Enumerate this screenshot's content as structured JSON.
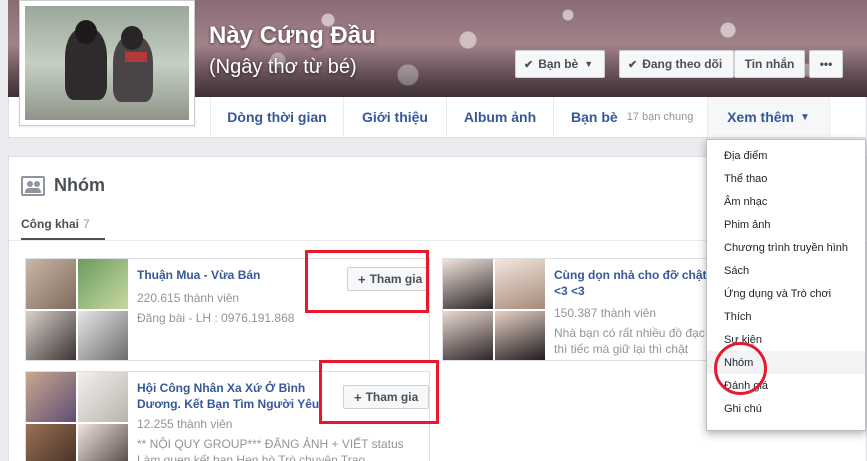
{
  "profile": {
    "name": "Này Cứng Đầu",
    "alt_name": "(Ngây thơ từ bé)"
  },
  "actions": {
    "friends": "Bạn bè",
    "following": "Đang theo dõi",
    "message": "Tin nhắn",
    "more": "•••"
  },
  "nav": {
    "timeline": "Dòng thời gian",
    "about": "Giới thiệu",
    "photos": "Album ảnh",
    "friends": "Bạn bè",
    "mutual": "17 bạn chung",
    "more": "Xem thêm"
  },
  "groups": {
    "title": "Nhóm",
    "subtab_label": "Công khai",
    "subtab_count": "7",
    "cards": [
      {
        "title": "Thuận Mua - Vừa Bán",
        "members": "220.615 thành viên",
        "desc": "Đăng bài - LH : 0976.191.868",
        "join": "Tham gia"
      },
      {
        "title": "Cùng dọn nhà cho đỡ chật <3 <3",
        "members": "150.387 thành viên",
        "desc": "Nhà bạn có rất nhiều đồ đạc thì tiếc mà giữ lại thì chật nhà"
      },
      {
        "title": "Hội Công Nhân Xa Xứ Ở Bình Dương. Kết Bạn Tìm Người Yêu",
        "members": "12.255 thành viên",
        "desc": "** NỘI QUY GROUP*** ĐĂNG ẢNH + VIẾT status Làm quen kết bạn Hẹn hò Trò chuyện Trao",
        "join": "Tham gia"
      }
    ]
  },
  "dropdown": {
    "items": [
      "Địa điểm",
      "Thể thao",
      "Âm nhạc",
      "Phim ảnh",
      "Chương trình truyền hình",
      "Sách",
      "Ứng dụng và Trò chơi",
      "Thích",
      "Sự kiện",
      "Nhóm",
      "Đánh giá",
      "Ghi chú"
    ]
  },
  "colors": {
    "link": "#365899",
    "highlight": "#e8192c"
  }
}
